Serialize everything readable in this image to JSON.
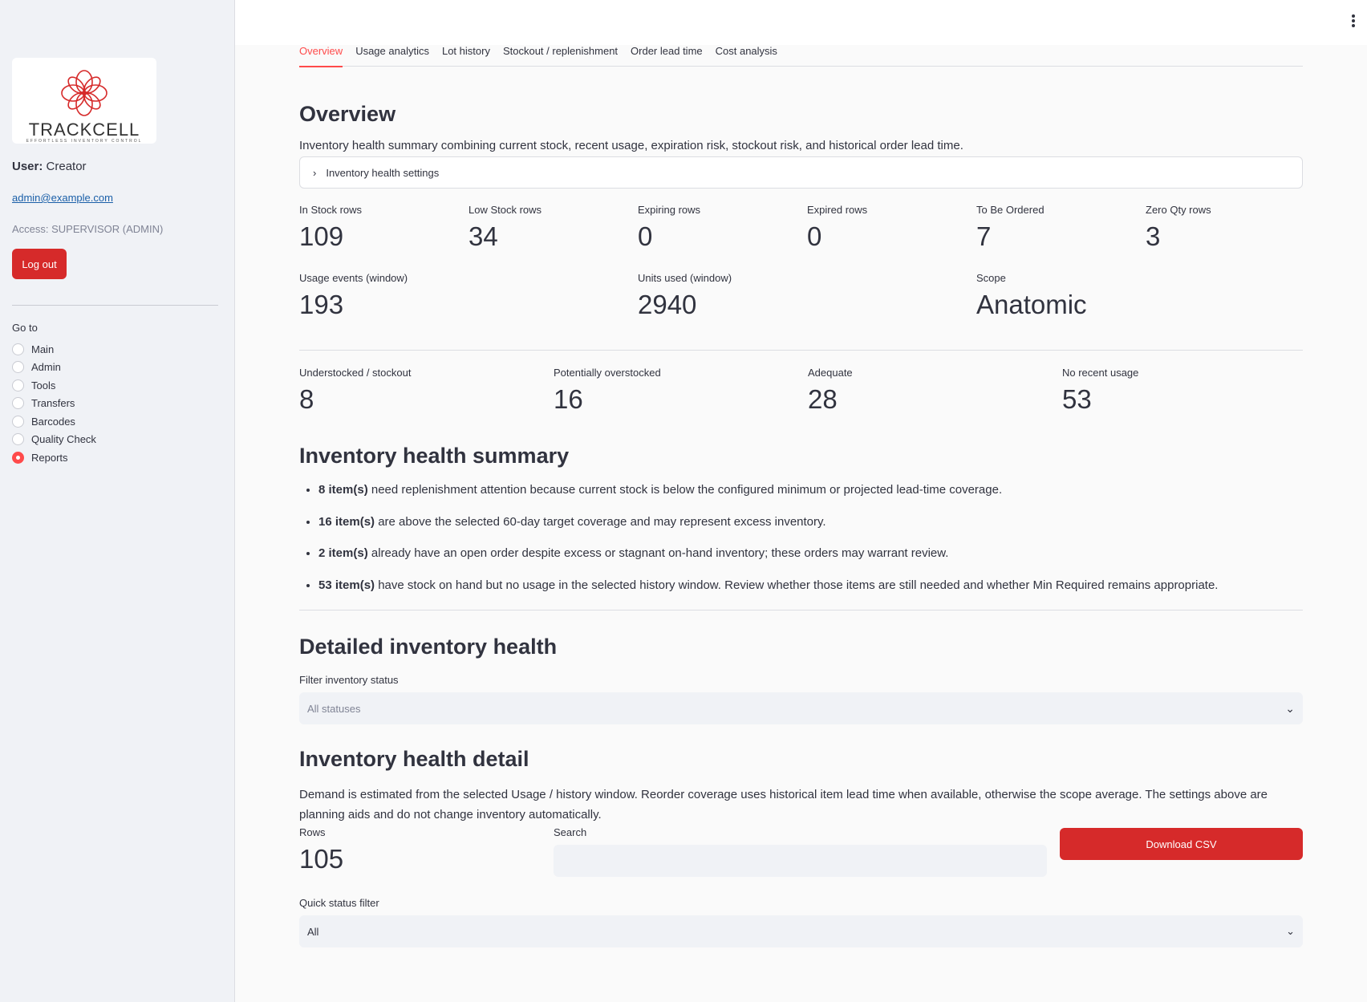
{
  "sidebar": {
    "logo": {
      "word": "TRACKCELL",
      "tagline": "EFFORTLESS INVENTORY CONTROL"
    },
    "user_label": "User:",
    "user_name": "Creator",
    "email": "admin@example.com",
    "access": "Access: SUPERVISOR (ADMIN)",
    "logout_label": "Log out",
    "goto_label": "Go to",
    "nav": [
      "Main",
      "Admin",
      "Tools",
      "Transfers",
      "Barcodes",
      "Quality Check",
      "Reports"
    ],
    "nav_selected": "Reports"
  },
  "colors": {
    "accent": "#ff4b4b",
    "button": "#d62a2a",
    "sidebar_bg": "#f0f2f6"
  },
  "tabs": [
    "Overview",
    "Usage analytics",
    "Lot history",
    "Stockout / replenishment",
    "Order lead time",
    "Cost analysis"
  ],
  "active_tab": "Overview",
  "overview": {
    "title": "Overview",
    "description": "Inventory health summary combining current stock, recent usage, expiration risk, stockout risk, and historical order lead time.",
    "settings_expander": "Inventory health settings",
    "metrics": [
      {
        "label": "In Stock rows",
        "value": "109"
      },
      {
        "label": "Low Stock rows",
        "value": "34"
      },
      {
        "label": "Expiring rows",
        "value": "0"
      },
      {
        "label": "Expired rows",
        "value": "0"
      },
      {
        "label": "To Be Ordered",
        "value": "7"
      },
      {
        "label": "Zero Qty rows",
        "value": "3"
      }
    ],
    "metrics_row2": [
      {
        "label": "Usage events (window)",
        "value": "193"
      },
      {
        "label": "Units used (window)",
        "value": "2940"
      },
      {
        "label": "Scope",
        "value": "Anatomic"
      }
    ],
    "metrics_row3": [
      {
        "label": "Understocked / stockout",
        "value": "8"
      },
      {
        "label": "Potentially overstocked",
        "value": "16"
      },
      {
        "label": "Adequate",
        "value": "28"
      },
      {
        "label": "No recent usage",
        "value": "53"
      }
    ]
  },
  "summary": {
    "title": "Inventory health summary",
    "bullets": [
      {
        "bold": "8 item(s)",
        "text": " need replenishment attention because current stock is below the configured minimum or projected lead-time coverage."
      },
      {
        "bold": "16 item(s)",
        "text": " are above the selected 60-day target coverage and may represent excess inventory."
      },
      {
        "bold": "2 item(s)",
        "text": " already have an open order despite excess or stagnant on-hand inventory; these orders may warrant review."
      },
      {
        "bold": "53 item(s)",
        "text": " have stock on hand but no usage in the selected history window. Review whether those items are still needed and whether Min Required remains appropriate."
      }
    ]
  },
  "detailed": {
    "title": "Detailed inventory health",
    "filter_label": "Filter inventory status",
    "filter_value": "All statuses"
  },
  "detail": {
    "title": "Inventory health detail",
    "description": "Demand is estimated from the selected Usage / history window. Reorder coverage uses historical item lead time when available, otherwise the scope average. The settings above are planning aids and do not change inventory automatically.",
    "rows_label": "Rows",
    "rows_value": "105",
    "search_label": "Search",
    "search_value": "",
    "download_label": "Download CSV",
    "quick_label": "Quick status filter",
    "quick_value": "All"
  }
}
